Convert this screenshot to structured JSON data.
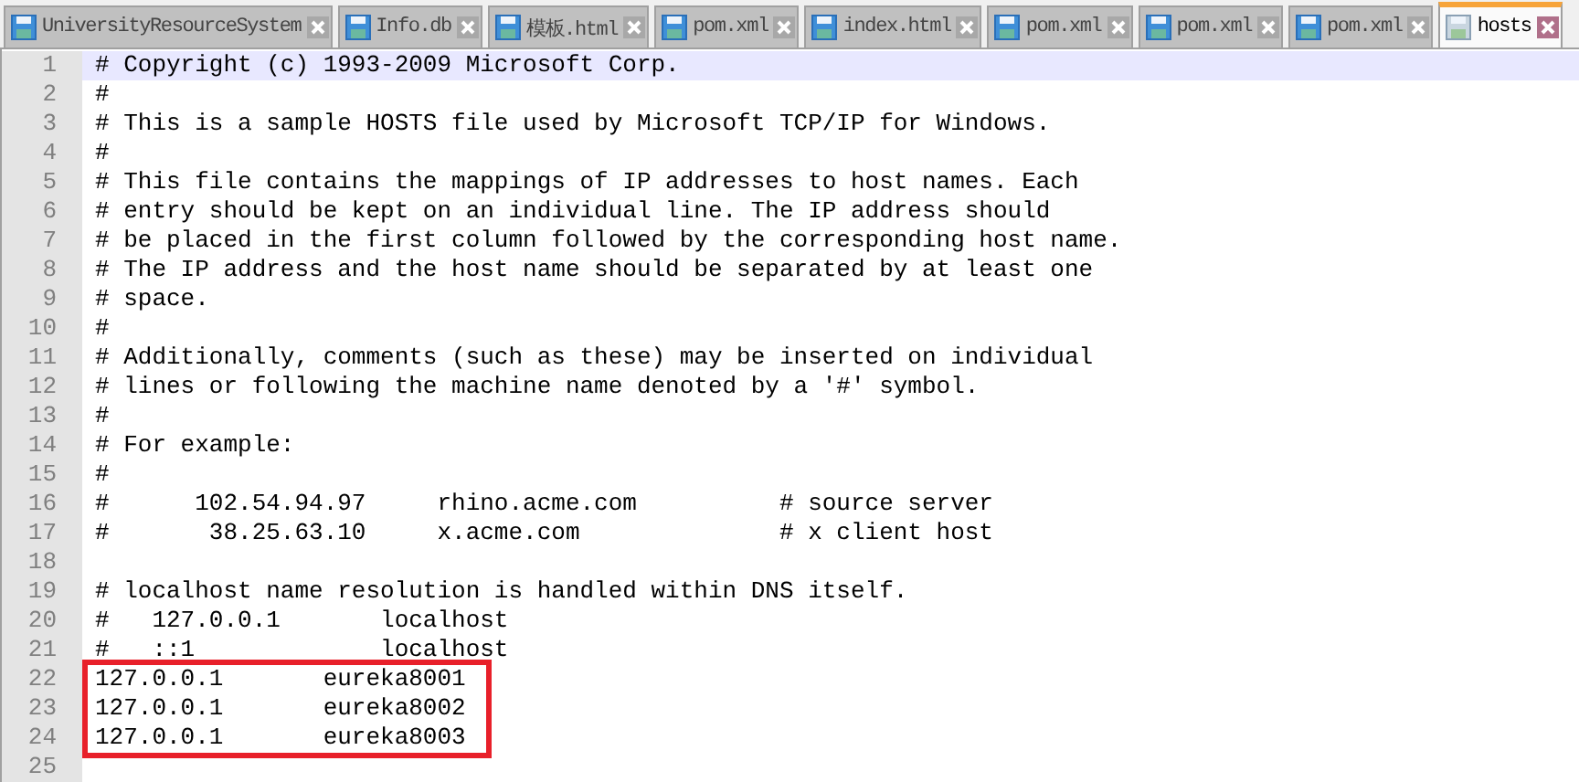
{
  "tabs": [
    {
      "label": "UniversityResourceSystem",
      "selected": false
    },
    {
      "label": "Info.db",
      "selected": false
    },
    {
      "label": "模板.html",
      "selected": false
    },
    {
      "label": "pom.xml",
      "selected": false
    },
    {
      "label": "index.html",
      "selected": false
    },
    {
      "label": "pom.xml",
      "selected": false
    },
    {
      "label": "pom.xml",
      "selected": false
    },
    {
      "label": "pom.xml",
      "selected": false
    },
    {
      "label": "hosts",
      "selected": true
    }
  ],
  "editor": {
    "lines": [
      {
        "number": "1",
        "text": "# Copyright (c) 1993-2009 Microsoft Corp.",
        "current": true,
        "boxed": false
      },
      {
        "number": "2",
        "text": "#",
        "current": false,
        "boxed": false
      },
      {
        "number": "3",
        "text": "# This is a sample HOSTS file used by Microsoft TCP/IP for Windows.",
        "current": false,
        "boxed": false
      },
      {
        "number": "4",
        "text": "#",
        "current": false,
        "boxed": false
      },
      {
        "number": "5",
        "text": "# This file contains the mappings of IP addresses to host names. Each",
        "current": false,
        "boxed": false
      },
      {
        "number": "6",
        "text": "# entry should be kept on an individual line. The IP address should",
        "current": false,
        "boxed": false
      },
      {
        "number": "7",
        "text": "# be placed in the first column followed by the corresponding host name.",
        "current": false,
        "boxed": false
      },
      {
        "number": "8",
        "text": "# The IP address and the host name should be separated by at least one",
        "current": false,
        "boxed": false
      },
      {
        "number": "9",
        "text": "# space.",
        "current": false,
        "boxed": false
      },
      {
        "number": "10",
        "text": "#",
        "current": false,
        "boxed": false
      },
      {
        "number": "11",
        "text": "# Additionally, comments (such as these) may be inserted on individual",
        "current": false,
        "boxed": false
      },
      {
        "number": "12",
        "text": "# lines or following the machine name denoted by a '#' symbol.",
        "current": false,
        "boxed": false
      },
      {
        "number": "13",
        "text": "#",
        "current": false,
        "boxed": false
      },
      {
        "number": "14",
        "text": "# For example:",
        "current": false,
        "boxed": false
      },
      {
        "number": "15",
        "text": "#",
        "current": false,
        "boxed": false
      },
      {
        "number": "16",
        "text": "#      102.54.94.97     rhino.acme.com          # source server",
        "current": false,
        "boxed": false
      },
      {
        "number": "17",
        "text": "#       38.25.63.10     x.acme.com              # x client host",
        "current": false,
        "boxed": false
      },
      {
        "number": "18",
        "current": false,
        "boxed": false
      },
      {
        "number": "19",
        "text": "# localhost name resolution is handled within DNS itself.",
        "current": false,
        "boxed": false
      },
      {
        "number": "20",
        "text": "#   127.0.0.1       localhost",
        "current": false,
        "boxed": false
      },
      {
        "number": "21",
        "text": "#   ::1             localhost",
        "current": false,
        "boxed": false
      },
      {
        "number": "22",
        "text": "127.0.0.1       eureka8001",
        "current": false,
        "boxed": true
      },
      {
        "number": "23",
        "text": "127.0.0.1       eureka8002",
        "current": false,
        "boxed": true
      },
      {
        "number": "24",
        "text": "127.0.0.1       eureka8003",
        "current": false,
        "boxed": true
      },
      {
        "number": "25",
        "current": false,
        "boxed": false
      }
    ]
  }
}
